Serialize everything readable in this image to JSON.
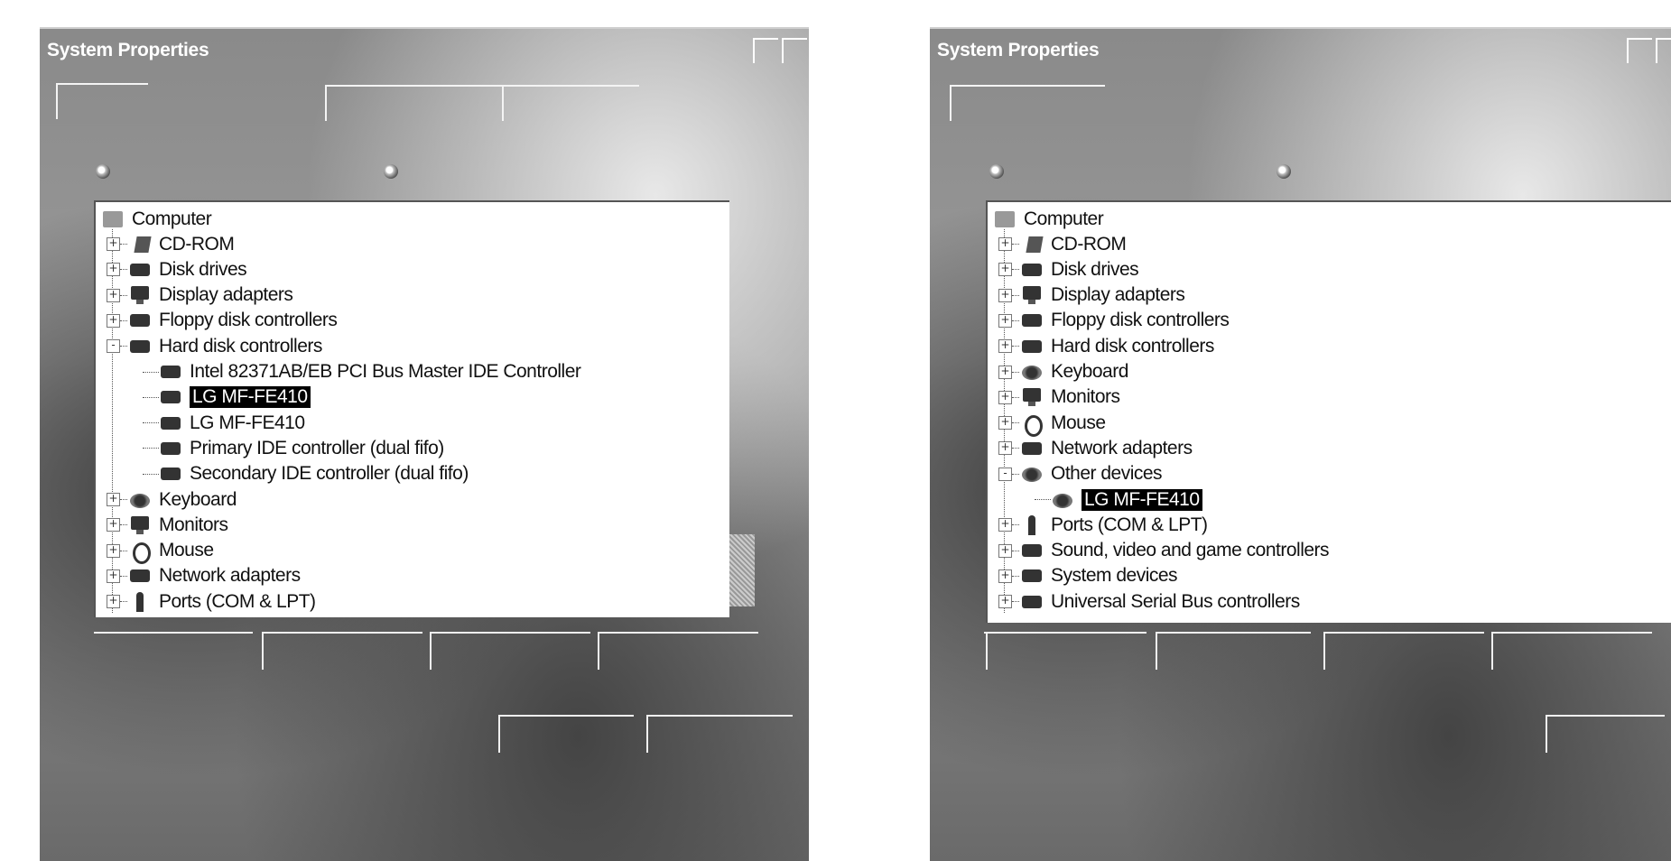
{
  "left_window": {
    "title": "System Properties",
    "tree": {
      "root": "Computer",
      "items": [
        {
          "label": "CD-ROM",
          "icon": "cdrom-icon",
          "expander": "+"
        },
        {
          "label": "Disk drives",
          "icon": "disk-drive-icon",
          "expander": "+"
        },
        {
          "label": "Display adapters",
          "icon": "display-adapter-icon",
          "expander": "+"
        },
        {
          "label": "Floppy disk controllers",
          "icon": "floppy-controller-icon",
          "expander": "+"
        },
        {
          "label": "Hard disk controllers",
          "icon": "hard-disk-controller-icon",
          "expander": "-"
        },
        {
          "label": "Intel 82371AB/EB PCI Bus Master IDE Controller",
          "icon": "ide-controller-icon",
          "child": true
        },
        {
          "label": "LG MF-FE410",
          "icon": "ide-controller-icon",
          "child": true,
          "selected": true
        },
        {
          "label": "LG MF-FE410",
          "icon": "ide-controller-icon",
          "child": true
        },
        {
          "label": "Primary IDE controller (dual fifo)",
          "icon": "ide-controller-icon",
          "child": true
        },
        {
          "label": "Secondary IDE controller (dual fifo)",
          "icon": "ide-controller-icon",
          "child": true
        },
        {
          "label": "Keyboard",
          "icon": "keyboard-icon",
          "expander": "+"
        },
        {
          "label": "Monitors",
          "icon": "monitor-icon",
          "expander": "+"
        },
        {
          "label": "Mouse",
          "icon": "mouse-icon",
          "expander": "+"
        },
        {
          "label": "Network adapters",
          "icon": "network-adapter-icon",
          "expander": "+"
        },
        {
          "label": "Ports (COM & LPT)",
          "icon": "port-icon",
          "expander": "+"
        }
      ]
    }
  },
  "right_window": {
    "title": "System Properties",
    "tree": {
      "root": "Computer",
      "items": [
        {
          "label": "CD-ROM",
          "icon": "cdrom-icon",
          "expander": "+"
        },
        {
          "label": "Disk drives",
          "icon": "disk-drive-icon",
          "expander": "+"
        },
        {
          "label": "Display adapters",
          "icon": "display-adapter-icon",
          "expander": "+"
        },
        {
          "label": "Floppy disk controllers",
          "icon": "floppy-controller-icon",
          "expander": "+"
        },
        {
          "label": "Hard disk controllers",
          "icon": "hard-disk-controller-icon",
          "expander": "+"
        },
        {
          "label": "Keyboard",
          "icon": "keyboard-icon",
          "expander": "+"
        },
        {
          "label": "Monitors",
          "icon": "monitor-icon",
          "expander": "+"
        },
        {
          "label": "Mouse",
          "icon": "mouse-icon",
          "expander": "+"
        },
        {
          "label": "Network adapters",
          "icon": "network-adapter-icon",
          "expander": "+"
        },
        {
          "label": "Other devices",
          "icon": "other-devices-icon",
          "expander": "-"
        },
        {
          "label": "LG MF-FE410",
          "icon": "unknown-device-icon",
          "child": true,
          "selected": true
        },
        {
          "label": "Ports (COM & LPT)",
          "icon": "port-icon",
          "expander": "+"
        },
        {
          "label": "Sound, video and game controllers",
          "icon": "sound-controller-icon",
          "expander": "+"
        },
        {
          "label": "System devices",
          "icon": "system-device-icon",
          "expander": "+"
        },
        {
          "label": "Universal Serial Bus controllers",
          "icon": "usb-controller-icon",
          "expander": "+"
        }
      ]
    }
  }
}
